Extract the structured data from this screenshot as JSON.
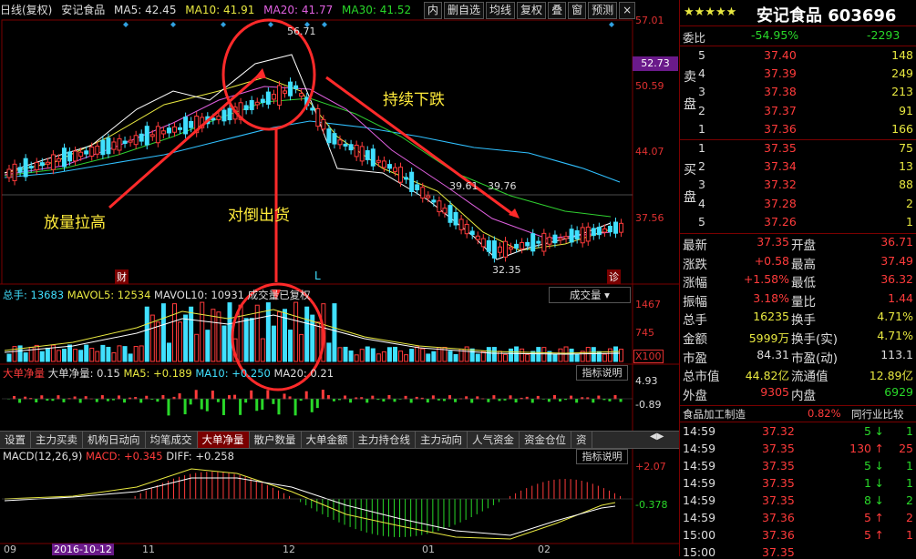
{
  "header": {
    "period": "日线(复权)",
    "stock_name": "安记食品",
    "ma5": "MA5: 42.45",
    "ma10": "MA10: 41.91",
    "ma20": "MA20: 41.77",
    "ma30": "MA30: 41.52",
    "toolbar": [
      "内",
      "drop",
      "均线",
      "复权",
      "叠",
      "窗",
      "预测"
    ]
  },
  "price_axis": {
    "labels": [
      "57.01",
      "52.73",
      "50.59",
      "44.07",
      "37.56"
    ],
    "current": "52.73"
  },
  "chart_annotations": {
    "high": "56.71",
    "mid1": "39.61",
    "mid2": "39.76",
    "low": "32.35",
    "marker_cai": "财",
    "marker_zhen": "诊",
    "marker_l": "L",
    "fanghang": "放量拉高",
    "duidao": "对倒出货",
    "chixu": "持续下跌"
  },
  "volume_panel": {
    "header": "总手: 13683",
    "mavol5": "MAVOL5: 12534",
    "mavol10": "MAVOL10: 10931",
    "note": "成交量已复权",
    "menu": "成交量",
    "axis": [
      "1467",
      "745",
      "X100"
    ]
  },
  "bignet_panel": {
    "label": "大单净量",
    "value_text": "大单净量: 0.15",
    "ma5": "MA5: +0.189",
    "ma10": "MA10: +0.250",
    "ma20": "MA20: 0.21",
    "button": "指标说明",
    "axis": [
      "4.93",
      "-0.89"
    ]
  },
  "tabs": [
    "设置",
    "主力买卖",
    "机构日动向",
    "均笔成交",
    "大单净量",
    "散户数量",
    "大单金额",
    "主力持仓线",
    "主力动向",
    "人气资金",
    "资金仓位",
    "资"
  ],
  "active_tab": "大单净量",
  "macd_panel": {
    "title": "MACD(12,26,9)",
    "macd": "MACD: +0.345",
    "diff": "DIFF: +0.258",
    "button": "指标说明",
    "axis": [
      "+2.07",
      "-0.378"
    ]
  },
  "date_axis": {
    "labels": [
      "09",
      "2016-10-12",
      "11",
      "12",
      "01",
      "02"
    ]
  },
  "quote": {
    "stars": "★★★★★",
    "title": "安记食品 603696",
    "weibi_label": "委比",
    "weibi": "-54.95%",
    "weicha": "-2293",
    "sell_label": "卖盘",
    "buy_label": "买盘",
    "sells": [
      [
        "5",
        "37.40",
        "148"
      ],
      [
        "4",
        "37.39",
        "249"
      ],
      [
        "3",
        "37.38",
        "213"
      ],
      [
        "2",
        "37.37",
        "91"
      ],
      [
        "1",
        "37.36",
        "166"
      ]
    ],
    "buys": [
      [
        "1",
        "37.35",
        "75"
      ],
      [
        "2",
        "37.34",
        "13"
      ],
      [
        "3",
        "37.32",
        "88"
      ],
      [
        "4",
        "37.28",
        "2"
      ],
      [
        "5",
        "37.26",
        "1"
      ]
    ],
    "stats": [
      [
        "最新",
        "37.35",
        "开盘",
        "36.71"
      ],
      [
        "涨跌",
        "+0.58",
        "最高",
        "37.49"
      ],
      [
        "涨幅",
        "+1.58%",
        "最低",
        "36.32"
      ],
      [
        "振幅",
        "3.18%",
        "量比",
        "1.44"
      ],
      [
        "总手",
        "16235",
        "换手",
        "4.71%"
      ],
      [
        "金额",
        "5999万",
        "换手(实)",
        "4.71%"
      ],
      [
        "市盈",
        "84.31",
        "市盈(动)",
        "113.1"
      ],
      [
        "总市值",
        "44.82亿",
        "流通值",
        "12.89亿"
      ],
      [
        "外盘",
        "9305",
        "内盘",
        "6929"
      ]
    ],
    "industry": "食品加工制造",
    "industry_pct": "0.82%",
    "compare": "同行业比较",
    "ticks": [
      [
        "14:59",
        "37.32",
        "5",
        "1"
      ],
      [
        "14:59",
        "37.35",
        "130",
        "25"
      ],
      [
        "14:59",
        "37.35",
        "5",
        "1"
      ],
      [
        "14:59",
        "37.35",
        "1",
        "1"
      ],
      [
        "14:59",
        "37.35",
        "8",
        "2"
      ],
      [
        "14:59",
        "37.36",
        "5",
        "2"
      ],
      [
        "15:00",
        "37.36",
        "5",
        "1"
      ],
      [
        "15:00",
        "37.35",
        "",
        ""
      ]
    ]
  }
}
